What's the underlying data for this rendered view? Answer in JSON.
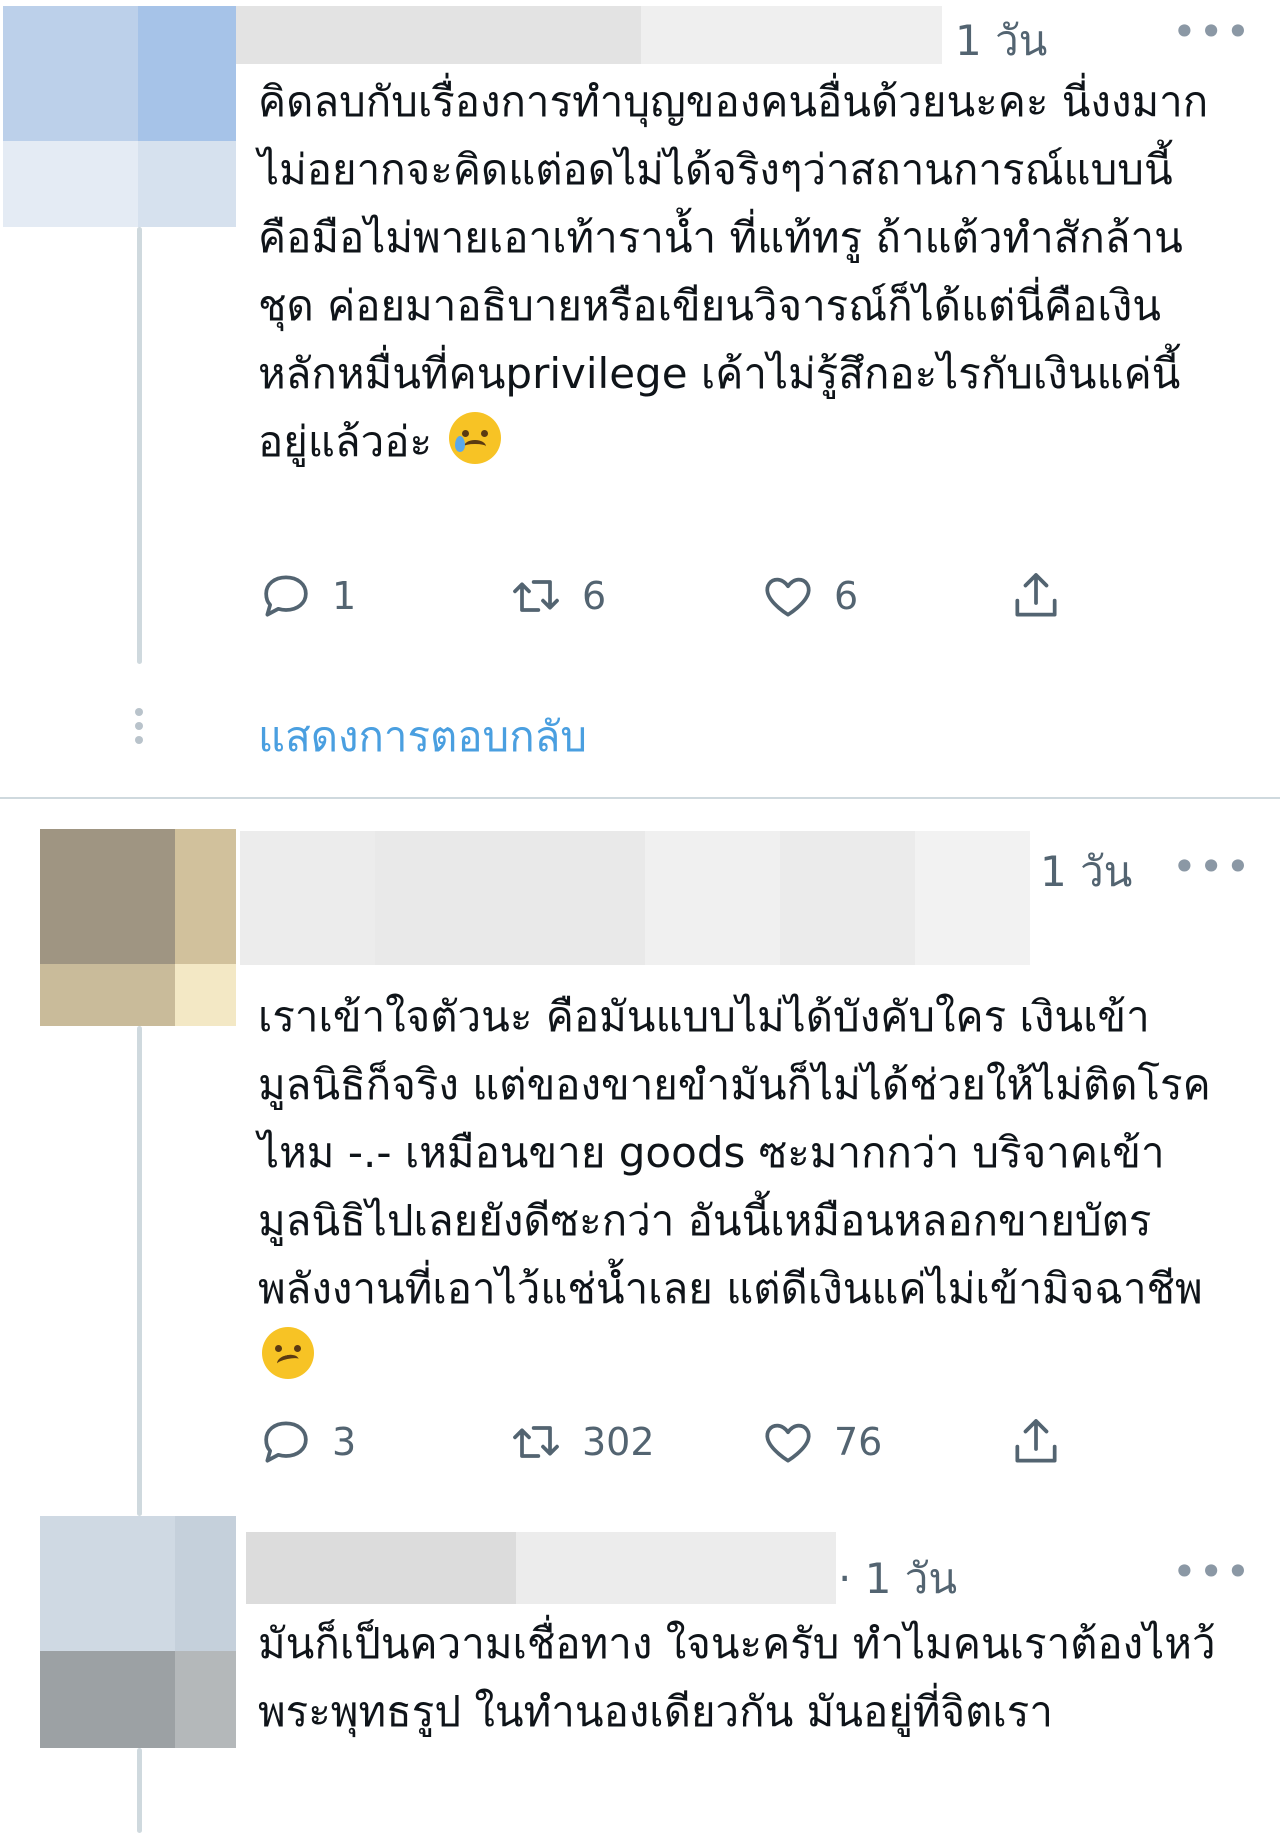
{
  "tweets": [
    {
      "time": "1 วัน",
      "more": "•••",
      "text": "คิดลบกับเรื่องการทำบุญของคนอื่นด้วยนะคะ นี่งงมาก ไม่อยากจะคิดแต่อดไม่ได้จริงๆว่าสถานการณ์แบบนี้คือมือไม่พายเอาเท้าราน้ำ ที่แท้ทรู ถ้าแต้วทำสักล้านชุด ค่อยมาอธิบายหรือเขียนวิจารณ์ก็ได้แต่นี่คือเงินหลักหมื่นที่คนprivilege เค้าไม่รู้สึกอะไรกับเงินแค่นี้อยู่แล้วอ่ะ",
      "emoji": "crying-face",
      "replies": "1",
      "retweets": "6",
      "likes": "6"
    },
    {
      "time": "1 วัน",
      "more": "•••",
      "text": "เราเข้าใจตัวนะ คือมันแบบไม่ได้บังคับใคร เงินเข้ามูลนิธิก็จริง แต่ของขายขำมันก็ไม่ได้ช่วยให้ไม่ติดโรคไหม -.- เหมือนขาย goods ซะมากกว่า บริจาคเข้ามูลนิธิไปเลยยังดีซะกว่า อันนี้เหมือนหลอกขายบัตรพลังงานที่เอาไว้แช่น้ำเลย แต่ดีเงินแค่ไม่เข้ามิจฉาชีพ",
      "emoji": "woozy-face",
      "replies": "3",
      "retweets": "302",
      "likes": "76"
    },
    {
      "time": "· 1 วัน",
      "more": "•••",
      "text": "มันก็เป็นความเชื่อทาง ใจนะครับ ทำไมคนเราต้องไหว้พระพุทธรูป ในทำนองเดียวกัน มันอยู่ที่จิตเรา"
    }
  ],
  "show_replies": "แสดงการตอบกลับ",
  "colors": {
    "link": "#4a9fe0",
    "icon": "#536471",
    "divider": "#cfd9de"
  }
}
